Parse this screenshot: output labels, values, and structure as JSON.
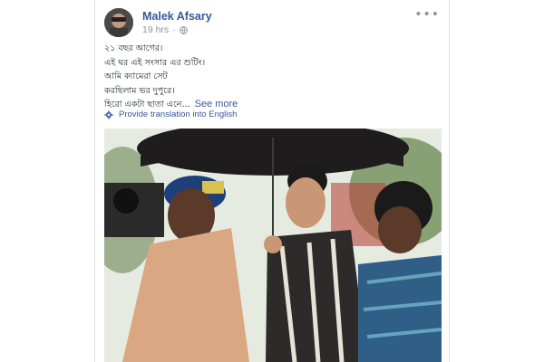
{
  "post": {
    "author_name": "Malek Afsary",
    "timestamp": "19 hrs",
    "separator": "·",
    "privacy_icon": "globe-icon",
    "options_icon": "more-options-icon",
    "text_lines": [
      "২১ বছর আগের।",
      "এই ঘর এই সংসার এর শুটিং।",
      "আমি ক্যামেরা সেট",
      "করছিলাম ভর দুপুরে।",
      "হিরো একটা ছাতা এনে..."
    ],
    "see_more": "See more",
    "translation_icon": "gear-icon",
    "translation_label": "Provide translation into English"
  },
  "photo": {
    "description_icon": "film-shooting-photo",
    "colors": {
      "umbrella": "#1e1c1c",
      "sky": "#e6ebe2",
      "foliage": "#6f8f5a",
      "cap": "#1d3f7a",
      "jacket_left": "#d9a882",
      "shirt_middle": "#2d2a2a",
      "shirt_right": "#2f5f86"
    }
  }
}
